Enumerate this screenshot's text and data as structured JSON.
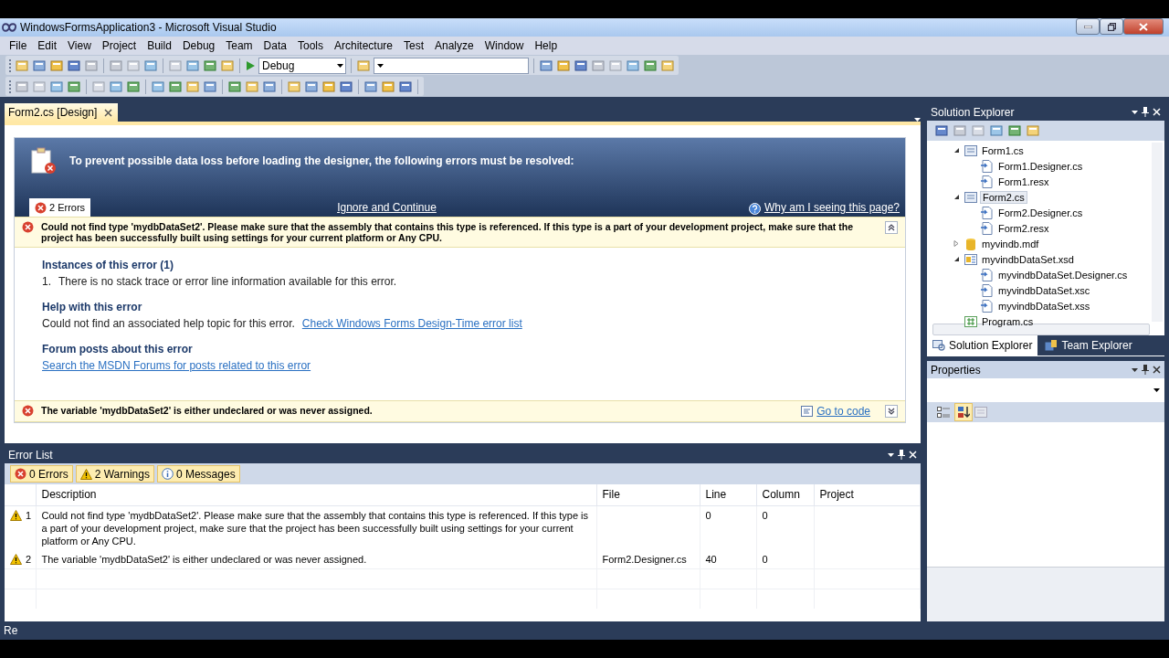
{
  "window": {
    "title": "WindowsFormsApplication3 - Microsoft Visual Studio"
  },
  "menu": [
    "File",
    "Edit",
    "View",
    "Project",
    "Build",
    "Debug",
    "Team",
    "Data",
    "Tools",
    "Architecture",
    "Test",
    "Analyze",
    "Window",
    "Help"
  ],
  "toolbar": {
    "configuration": "Debug"
  },
  "document_tab": {
    "label": "Form2.cs [Design]",
    "selected": true
  },
  "designer_errors": {
    "banner": "To prevent possible data loss before loading the designer, the following errors must be resolved:",
    "errors_tab": "2 Errors",
    "ignore_link": "Ignore and Continue",
    "why_link": "Why am I seeing this page?",
    "errors": [
      {
        "message": "Could not find type 'mydbDataSet2'. Please make sure that the assembly that contains this type is referenced. If this type is a part of your development project, make sure that the project has been successfully built using settings for your current platform or Any CPU.",
        "expanded": true,
        "instances_heading": "Instances of this error (1)",
        "instances": [
          {
            "number": "1.",
            "text": "There is no stack trace or error line information available for this error."
          }
        ],
        "help_heading": "Help with this error",
        "help_text": "Could not find an associated help topic for this error.",
        "help_link": "Check Windows Forms Design-Time error list",
        "forum_heading": "Forum posts about this error",
        "forum_link": "Search the MSDN Forums for posts related to this error"
      },
      {
        "message": "The variable 'mydbDataSet2' is either undeclared or was never assigned.",
        "expanded": false,
        "goto_link": "Go to code"
      }
    ]
  },
  "error_list": {
    "title": "Error List",
    "filters": [
      {
        "kind": "error",
        "label": "0 Errors",
        "selected": true
      },
      {
        "kind": "warning",
        "label": "2 Warnings",
        "selected": true
      },
      {
        "kind": "message",
        "label": "0 Messages",
        "selected": true
      }
    ],
    "columns": [
      "Description",
      "File",
      "Line",
      "Column",
      "Project"
    ],
    "rows": [
      {
        "kind": "warning",
        "number": "1",
        "description": "Could not find type 'mydbDataSet2'.  Please make sure that the assembly that contains this type is referenced.  If this type is a part of your development project, make sure that the project has been successfully built using settings for your current platform or Any CPU.",
        "line": "0",
        "column": "0"
      },
      {
        "kind": "warning",
        "number": "2",
        "description": "The variable 'mydbDataSet2' is either undeclared or was never assigned.",
        "file": "Form2.Designer.cs",
        "line": "40",
        "column": "0"
      }
    ]
  },
  "solution_explorer": {
    "title": "Solution Explorer",
    "tree": [
      {
        "label": "Form1.cs",
        "kind": "form",
        "expanded": true,
        "selected": false,
        "children": [
          {
            "label": "Form1.Designer.cs",
            "kind": "file",
            "selected": false
          },
          {
            "label": "Form1.resx",
            "kind": "file",
            "selected": false
          }
        ]
      },
      {
        "label": "Form2.cs",
        "kind": "form",
        "expanded": true,
        "selected": true,
        "children": [
          {
            "label": "Form2.Designer.cs",
            "kind": "file",
            "selected": false
          },
          {
            "label": "Form2.resx",
            "kind": "file",
            "selected": false
          }
        ]
      },
      {
        "label": "myvindb.mdf",
        "kind": "database",
        "expanded": false,
        "selected": false
      },
      {
        "label": "myvindbDataSet.xsd",
        "kind": "dataset",
        "expanded": true,
        "selected": false,
        "children": [
          {
            "label": "myvindbDataSet.Designer.cs",
            "kind": "file",
            "selected": false
          },
          {
            "label": "myvindbDataSet.xsc",
            "kind": "file",
            "selected": false
          },
          {
            "label": "myvindbDataSet.xss",
            "kind": "file",
            "selected": false
          }
        ]
      },
      {
        "label": "Program.cs",
        "kind": "csharp",
        "selected": false
      }
    ],
    "tabs": [
      {
        "label": "Solution Explorer",
        "selected": true
      },
      {
        "label": "Team Explorer",
        "selected": false
      }
    ]
  },
  "properties": {
    "title": "Properties",
    "view_buttons": [
      {
        "kind": "categorized",
        "selected": false
      },
      {
        "kind": "alphabetical",
        "selected": true
      }
    ]
  },
  "status_bar": {
    "text": "Re"
  }
}
